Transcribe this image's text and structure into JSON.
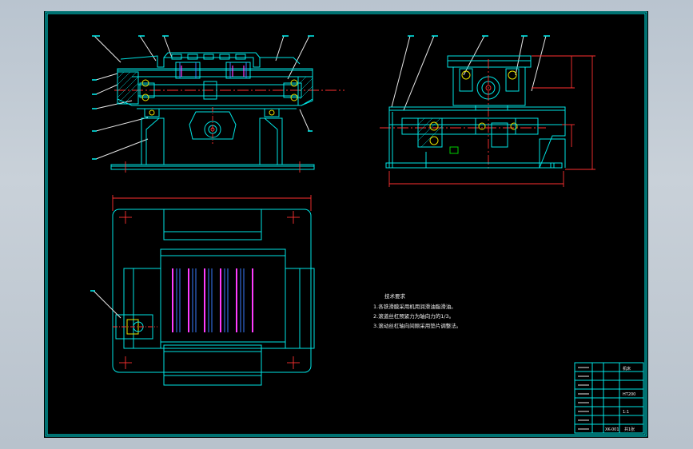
{
  "drawing": {
    "tech_requirements": {
      "title": "技术要求",
      "lines": [
        "1.各铁滑膜采用机用润滑油脂滑油。",
        "2.滚道丝杠预紧力为轴向力的1/3。",
        "3.滚动丝杠轴向间隙采用垫片调整法。"
      ]
    },
    "title_block": {
      "drawing_name": "机床",
      "material_code": "HT200",
      "scale": "1:1",
      "drawing_no": "XK-001",
      "sheet": "共1张"
    }
  },
  "colors": {
    "canvas": "#000000",
    "outline": "#00e5e5",
    "center_line": "#ff3030",
    "screw_threads": "#ff3cff",
    "leader_lines": "#e6e6e6",
    "app_background": "#bcc6d0"
  }
}
